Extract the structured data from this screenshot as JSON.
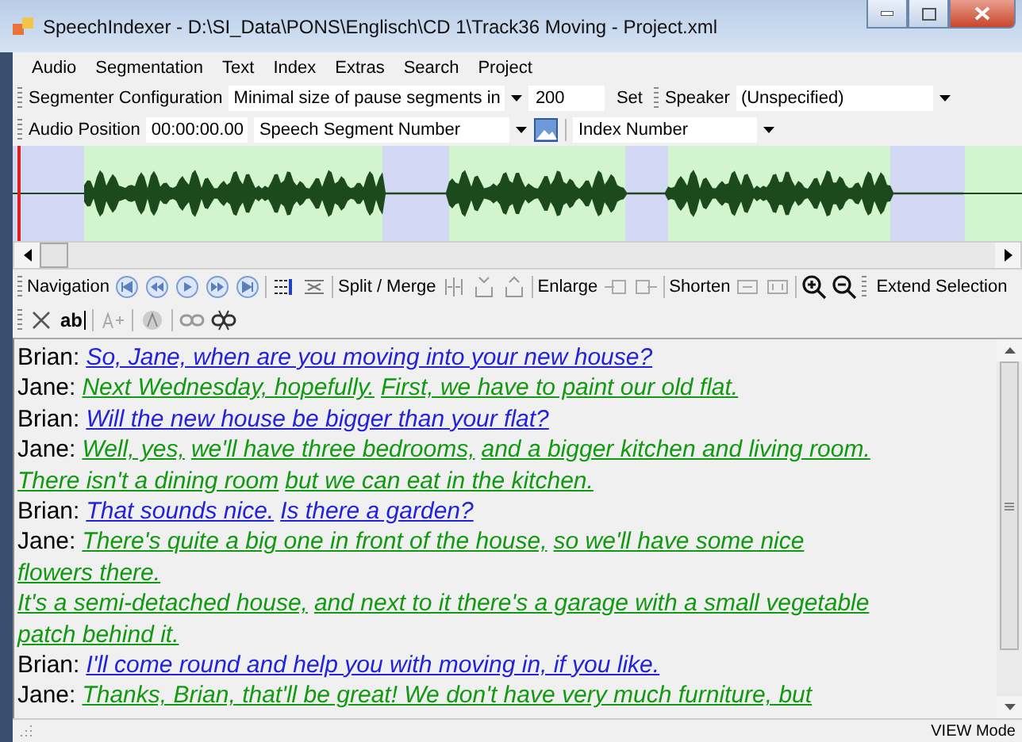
{
  "window": {
    "title": "SpeechIndexer - D:\\SI_Data\\PONS\\Englisch\\CD 1\\Track36 Moving - Project.xml"
  },
  "menu": [
    "Audio",
    "Segmentation",
    "Text",
    "Index",
    "Extras",
    "Search",
    "Project"
  ],
  "segmenter_toolbar": {
    "label": "Segmenter Configuration",
    "mode": "Minimal size of pause segments in",
    "value": "200",
    "set_button": "Set",
    "speaker_label": "Speaker",
    "speaker": "(Unspecified)"
  },
  "position_toolbar": {
    "label": "Audio Position",
    "time": "00:00:00.00",
    "segment": "Speech Segment Number",
    "index": "Index Number"
  },
  "edit_toolbar": {
    "navigation": "Navigation",
    "split_merge": "Split / Merge",
    "enlarge": "Enlarge",
    "shorten": "Shorten",
    "extend": "Extend Selection"
  },
  "format_toolbar": {
    "text_tool": "ab"
  },
  "transcript": [
    {
      "speaker": "Brian:",
      "color": "#2222dd",
      "segments": [
        "So, Jane, when are you moving into your new house?"
      ]
    },
    {
      "speaker": "Jane:",
      "color": "#119911",
      "segments": [
        "Next Wednesday, hopefully.",
        "First, we have to paint our old flat."
      ]
    },
    {
      "speaker": "Brian:",
      "color": "#2222dd",
      "segments": [
        "Will the new house be bigger than your flat?"
      ]
    },
    {
      "speaker": "Jane:",
      "color": "#119911",
      "segments": [
        "Well, yes,",
        "we'll have three bedrooms,",
        "and a bigger kitchen and living room."
      ]
    },
    {
      "color": "#119911",
      "segments": [
        "There isn't a dining room",
        "but we can eat in the kitchen."
      ]
    },
    {
      "speaker": "Brian:",
      "color": "#2222dd",
      "segments": [
        "That sounds nice.",
        "Is there a garden?"
      ]
    },
    {
      "speaker": "Jane:",
      "color": "#119911",
      "segments": [
        "There's quite a big one in front of the house,",
        "so we'll have some nice"
      ]
    },
    {
      "color": "#119911",
      "segments": [
        "flowers there."
      ]
    },
    {
      "color": "#119911",
      "segments": [
        "It's a semi-detached house,",
        "and next to it there's a garage with a small vegetable"
      ]
    },
    {
      "color": "#119911",
      "segments": [
        "patch behind it."
      ]
    },
    {
      "speaker": "Brian:",
      "color": "#2222dd",
      "segments": [
        "I'll come round and help you with moving in, if you like."
      ]
    },
    {
      "speaker": "Jane:",
      "color": "#119911",
      "segments": [
        "Thanks, Brian, that'll be great! We don't have very much furniture, but"
      ]
    }
  ],
  "status_bar": {
    "mode": "VIEW Mode"
  }
}
